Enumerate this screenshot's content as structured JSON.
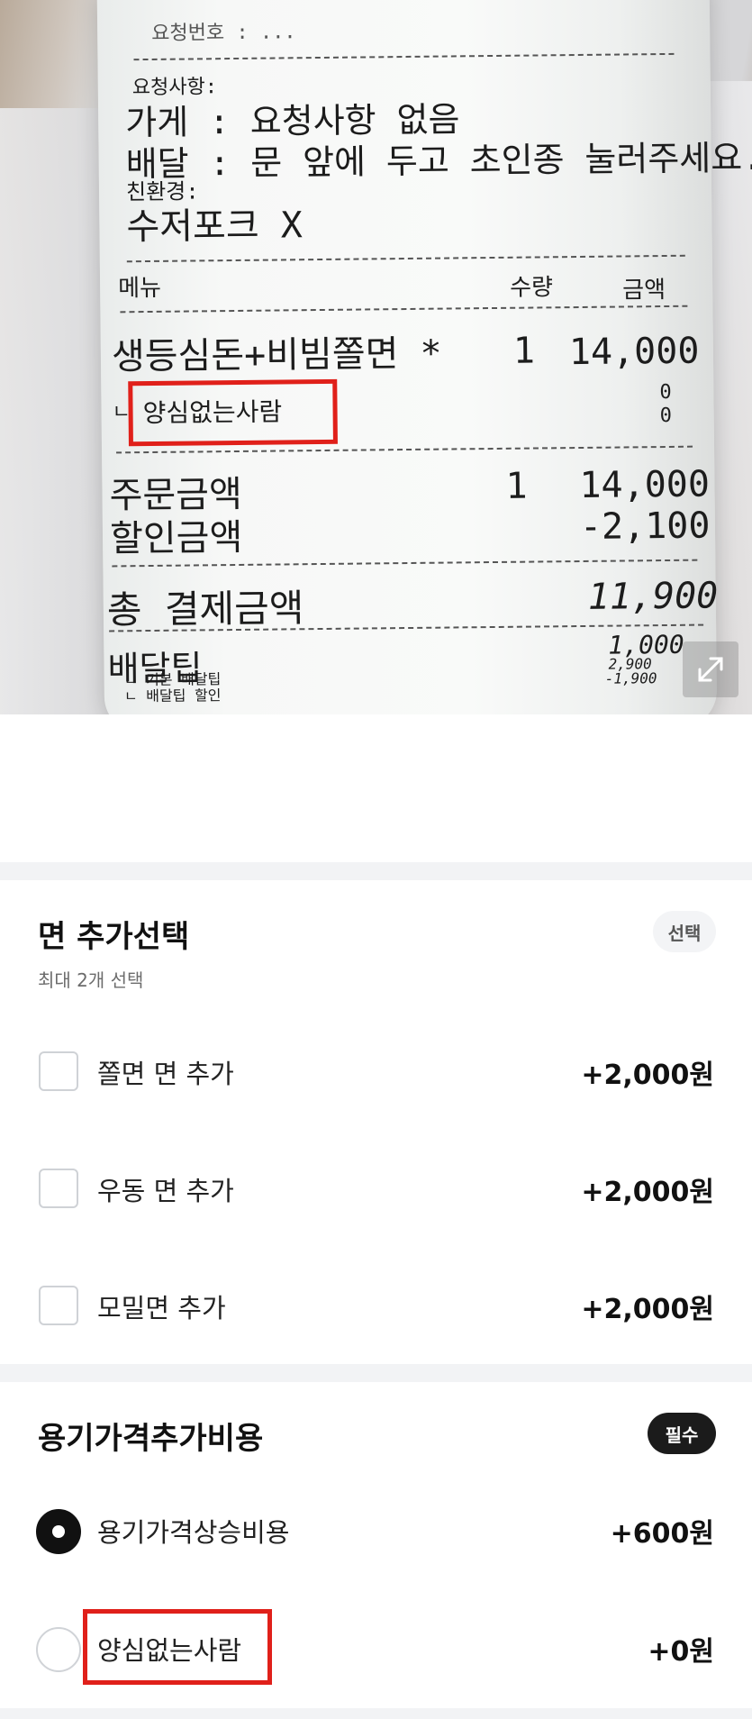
{
  "receipt": {
    "top_scribble": "요청번호 : ...",
    "request_header": "요청사항:",
    "store_request": "가게 : 요청사항 없음",
    "delivery_request": "배달 : 문 앞에 두고 초인종 눌러주세요.",
    "eco_header": "친환경:",
    "eco_value": "수저포크 X",
    "col_menu": "메뉴",
    "col_qty": "수량",
    "col_amount": "금액",
    "item_name": "생등심돈+비빔쫄면 *",
    "item_qty": "1",
    "item_amount": "14,000",
    "option_prefix": "ㄴ",
    "option_name": "양심없는사람",
    "option_amount_1": "0",
    "option_amount_2": "0",
    "order_amount_label": "주문금액",
    "order_amount_qty": "1",
    "order_amount": "14,000",
    "discount_label": "할인금액",
    "discount_amount": "-2,100",
    "total_label": "총 결제금액",
    "total_amount": "11,900",
    "delivery_tip_label": "배달팁",
    "delivery_tip_amount": "1,000",
    "basic_tip_label": "ㄴ 기본 배달팁",
    "basic_tip_amount": "2,900",
    "tip_discount_label": "ㄴ 배달팁 할인",
    "tip_discount_amount": "-1,900"
  },
  "expand_icon": "expand-arrows-icon",
  "noodle_section": {
    "title": "면 추가선택",
    "subtitle": "최대 2개 선택",
    "badge": "선택",
    "options": [
      {
        "label": "쫄면 면 추가",
        "price": "+2,000원",
        "checked": false
      },
      {
        "label": "우동 면 추가",
        "price": "+2,000원",
        "checked": false
      },
      {
        "label": "모밀면 추가",
        "price": "+2,000원",
        "checked": false
      }
    ]
  },
  "container_section": {
    "title": "용기가격추가비용",
    "badge": "필수",
    "options": [
      {
        "label": "용기가격상승비용",
        "price": "+600원",
        "selected": true
      },
      {
        "label": "양심없는사람",
        "price": "+0원",
        "selected": false
      }
    ]
  },
  "colors": {
    "highlight": "#e0201a",
    "separator": "#f2f3f5",
    "required_badge": "#1b1b1b"
  }
}
